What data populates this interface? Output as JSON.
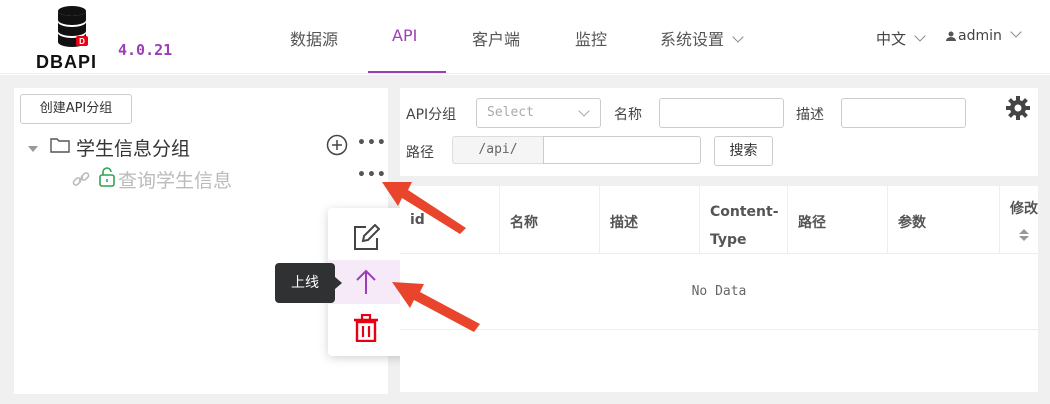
{
  "header": {
    "logo_text": "DBAPI",
    "version": "4.0.21",
    "nav": [
      {
        "label": "数据源"
      },
      {
        "label": "API"
      },
      {
        "label": "客户端"
      },
      {
        "label": "监控"
      },
      {
        "label": "系统设置"
      }
    ],
    "language": "中文",
    "user": "admin"
  },
  "left_panel": {
    "create_button": "创建API分组",
    "group": {
      "label": "学生信息分组",
      "api": {
        "label": "查询学生信息"
      }
    },
    "dots": "•••",
    "tooltip": "上线"
  },
  "search": {
    "group_label": "API分组",
    "group_placeholder": "Select",
    "name_label": "名称",
    "desc_label": "描述",
    "path_label": "路径",
    "path_prefix": "/api/",
    "search_button": "搜索"
  },
  "table": {
    "columns": [
      "id",
      "名称",
      "描述",
      "Content-",
      "Type",
      "路径",
      "参数",
      "修改"
    ],
    "empty_text": "No Data"
  },
  "colors": {
    "accent": "#9c3fb6",
    "delete": "#e60012",
    "annotation": "#e8452c"
  }
}
